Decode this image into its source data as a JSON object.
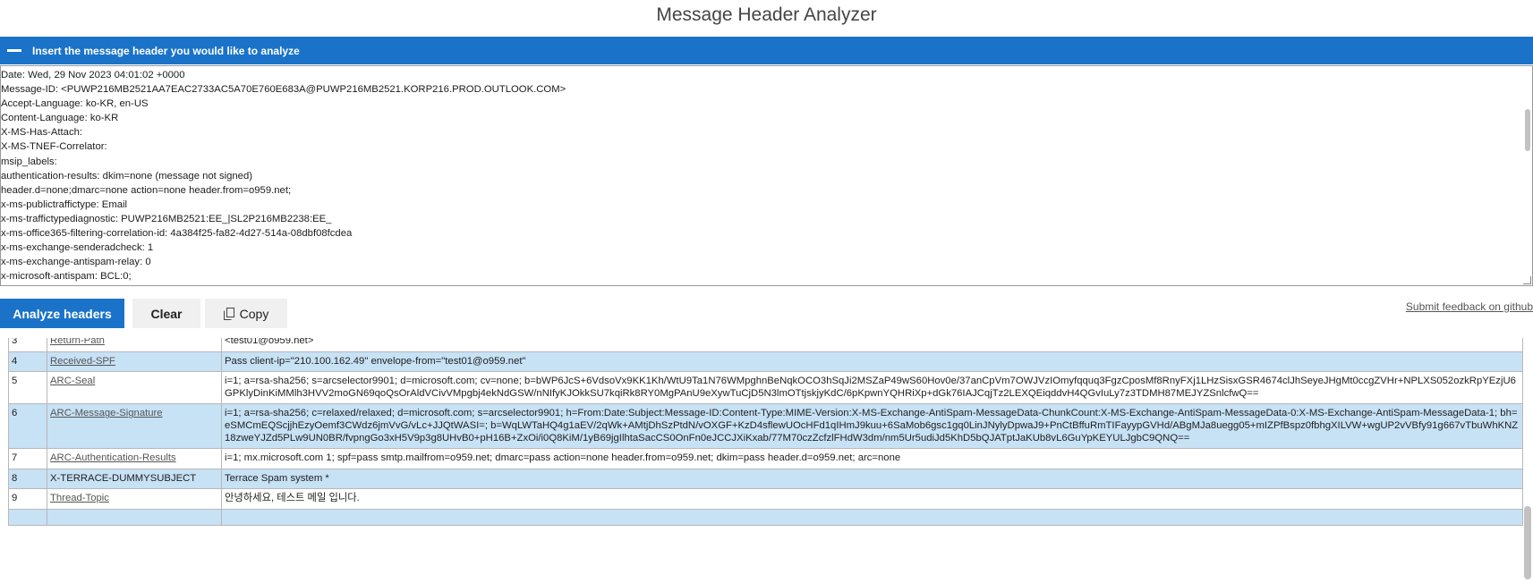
{
  "page": {
    "title": "Message Header Analyzer"
  },
  "input_section": {
    "bar_label": "Insert the message header you would like to analyze",
    "header_lines": [
      "Date: Wed, 29 Nov 2023 04:01:02 +0000",
      "Message-ID: <PUWP216MB2521AA7EAC2733AC5A70E760E683A@PUWP216MB2521.KORP216.PROD.OUTLOOK.COM>",
      "Accept-Language: ko-KR, en-US",
      "Content-Language: ko-KR",
      "X-MS-Has-Attach:",
      "X-MS-TNEF-Correlator:",
      "msip_labels:",
      "authentication-results: dkim=none (message not signed)",
      "header.d=none;dmarc=none action=none header.from=o959.net;",
      "x-ms-publictraffictype: Email",
      "x-ms-traffictypediagnostic: PUWP216MB2521:EE_|SL2P216MB2238:EE_",
      "x-ms-office365-filtering-correlation-id: 4a384f25-fa82-4d27-514a-08dbf08fcdea",
      "x-ms-exchange-senderadcheck: 1",
      "x-ms-exchange-antispam-relay: 0",
      "x-microsoft-antispam: BCL:0;"
    ]
  },
  "buttons": {
    "analyze": "Analyze headers",
    "clear": "Clear",
    "copy": "Copy"
  },
  "feedback_link": "Submit feedback on github",
  "icons": {
    "copy": "copy-icon",
    "collapse": "minus-icon"
  },
  "colors": {
    "accent": "#1a73c9",
    "row_highlight": "#c7e1f5"
  },
  "table": {
    "rows": [
      {
        "num": "3",
        "name": "Return-Path",
        "link": true,
        "value": "<test01@o959.net>"
      },
      {
        "num": "4",
        "name": "Received-SPF",
        "link": true,
        "value": "Pass client-ip=\"210.100.162.49\" envelope-from=\"test01@o959.net\""
      },
      {
        "num": "5",
        "name": "ARC-Seal",
        "link": true,
        "value": "i=1; a=rsa-sha256; s=arcselector9901; d=microsoft.com; cv=none; b=bWP6JcS+6VdsoVx9KK1Kh/WtU9Ta1N76WMpghnBeNqkOCO3hSqJi2MSZaP49wS60Hov0e/37anCpVm7OWJVzIOmyfqquq3FgzCposMf8RnyFXj1LHzSisxGSR4674clJhSeyeJHgMt0ccgZVHr+NPLXS052ozkRpYEzjU6GPKlyDinKiMMlh3HVV2moGN69qoQsOrAldVCivVMpgbj4ekNdGSW/nNIfyKJOkkSU7kqiRk8RY0MgPAnU9eXywTuCjD5N3lmOTtjskjyKdC/6pKpwnYQHRiXp+dGk76IAJCqjTz2LEXQEiqddvH4QGvIuLy7z3TDMH87MEJYZSnlcfwQ=="
      },
      {
        "num": "6",
        "name": "ARC-Message-Signature",
        "link": true,
        "value": "i=1; a=rsa-sha256; c=relaxed/relaxed; d=microsoft.com; s=arcselector9901; h=From:Date:Subject:Message-ID:Content-Type:MIME-Version:X-MS-Exchange-AntiSpam-MessageData-ChunkCount:X-MS-Exchange-AntiSpam-MessageData-0:X-MS-Exchange-AntiSpam-MessageData-1; bh=eSMCmEQScjjhEzyOemf3CWdz6jmVvG/vLc+JJQtWASI=; b=WqLWTaHQ4g1aEV/2qWk+AMtjDhSzPtdN/vOXGF+KzD4sflewUOcHFd1qIHmJ9kuu+6SaMob6gsc1gq0LinJNylyDpwaJ9+PnCtBffuRmTIFayypGVHd/ABgMJa8uegg05+mIZPfBspz0fbhgXILVW+wgUP2vVBfy91g667vTbuWhKNZ18zweYJZd5PLw9UN0BR/fvpngGo3xH5V9p3g8UHvB0+pH16B+ZxOi/i0Q8KiM/1yB69jgIlhtaSacCS0OnFn0eJCCJXiKxab/77M70czZcfzlFHdW3dm/nm5Ur5udiJd5KhD5bQJATptJaKUb8vL6GuYpKEYULJgbC9QNQ=="
      },
      {
        "num": "7",
        "name": "ARC-Authentication-Results",
        "link": true,
        "value": "i=1; mx.microsoft.com 1; spf=pass smtp.mailfrom=o959.net; dmarc=pass action=none header.from=o959.net; dkim=pass header.d=o959.net; arc=none"
      },
      {
        "num": "8",
        "name": "X-TERRACE-DUMMYSUBJECT",
        "link": false,
        "value": "Terrace Spam system *"
      },
      {
        "num": "9",
        "name": "Thread-Topic",
        "link": true,
        "value": "안녕하세요, 테스트 메일 입니다."
      },
      {
        "num": "",
        "name": "",
        "link": false,
        "value": ""
      }
    ]
  }
}
